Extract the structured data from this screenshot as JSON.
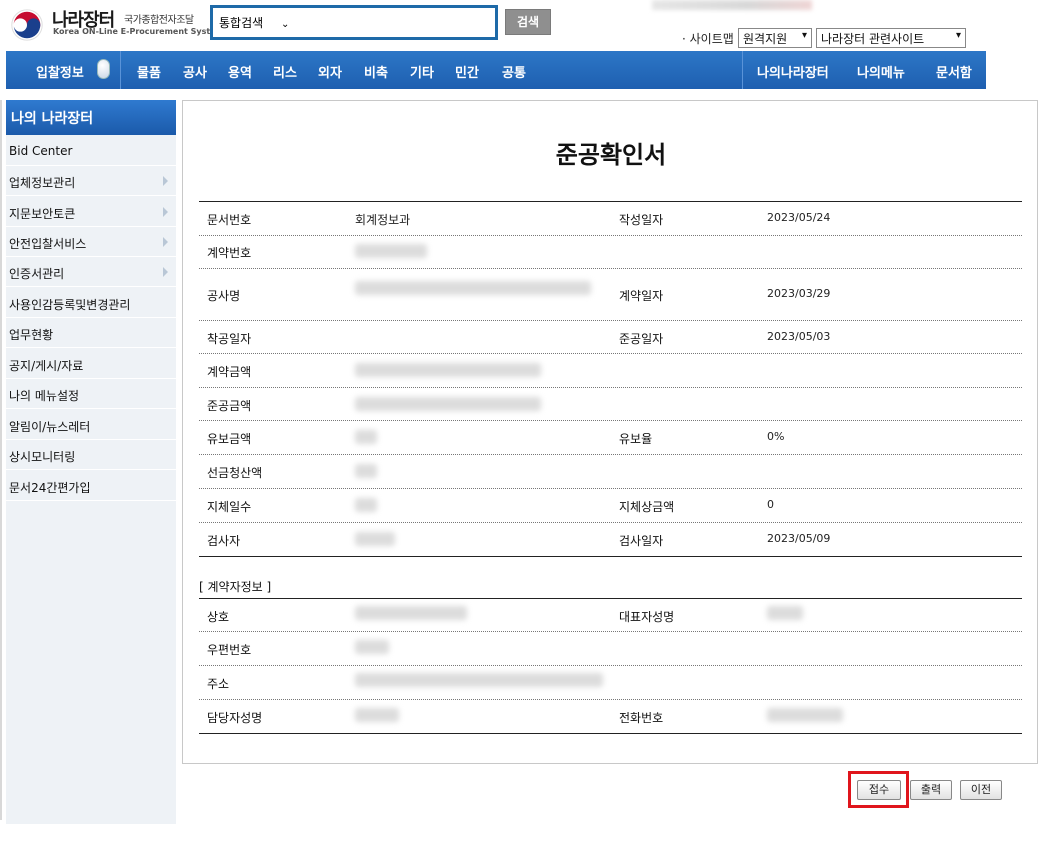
{
  "header": {
    "logo_kr": "나라장터",
    "logo_sub": "국가종합전자조달",
    "logo_en": "Korea ON-Line E-Procurement System",
    "search_select": "통합검색",
    "search_button": "검색",
    "sitemap": "· 사이트맵",
    "remote_support": "원격지원",
    "related_sites": "나라장터 관련사이트"
  },
  "nav": {
    "items": [
      "입찰정보",
      "물품",
      "공사",
      "용역",
      "리스",
      "외자",
      "비축",
      "기타",
      "민간",
      "공통"
    ],
    "right": [
      "나의나라장터",
      "나의메뉴",
      "문서함"
    ]
  },
  "sidebar": {
    "title": "나의 나라장터",
    "items": [
      {
        "label": "Bid Center",
        "arrow": false
      },
      {
        "label": "업체정보관리",
        "arrow": true
      },
      {
        "label": "지문보안토큰",
        "arrow": true
      },
      {
        "label": "안전입찰서비스",
        "arrow": true
      },
      {
        "label": "인증서관리",
        "arrow": true
      },
      {
        "label": "사용인감등록및변경관리",
        "arrow": false
      },
      {
        "label": "업무현황",
        "arrow": false
      },
      {
        "label": "공지/게시/자료",
        "arrow": false
      },
      {
        "label": "나의 메뉴설정",
        "arrow": false
      },
      {
        "label": "알림이/뉴스레터",
        "arrow": false
      },
      {
        "label": "상시모니터링",
        "arrow": false
      },
      {
        "label": "문서24간편가입",
        "arrow": false
      }
    ]
  },
  "document": {
    "title": "준공확인서",
    "fields": {
      "doc_no_label": "문서번호",
      "doc_no_value": "회계정보과",
      "written_date_label": "작성일자",
      "written_date_value": "2023/05/24",
      "contract_no_label": "계약번호",
      "project_name_label": "공사명",
      "contract_date_label": "계약일자",
      "contract_date_value": "2023/03/29",
      "start_date_label": "착공일자",
      "complete_date_label": "준공일자",
      "complete_date_value": "2023/05/03",
      "contract_amount_label": "계약금액",
      "complete_amount_label": "준공금액",
      "retention_amount_label": "유보금액",
      "retention_rate_label": "유보율",
      "retention_rate_value": "0%",
      "advance_label": "선금청산액",
      "delay_days_label": "지체일수",
      "delay_penalty_label": "지체상금액",
      "delay_penalty_value": "0",
      "inspector_label": "검사자",
      "inspection_date_label": "검사일자",
      "inspection_date_value": "2023/05/09"
    },
    "contractor_section": "[ 계약자정보 ]",
    "contractor": {
      "company_label": "상호",
      "ceo_label": "대표자성명",
      "postal_label": "우편번호",
      "address_label": "주소",
      "manager_label": "담당자성명",
      "phone_label": "전화번호"
    }
  },
  "buttons": {
    "receive": "접수",
    "print": "출력",
    "prev": "이전"
  }
}
